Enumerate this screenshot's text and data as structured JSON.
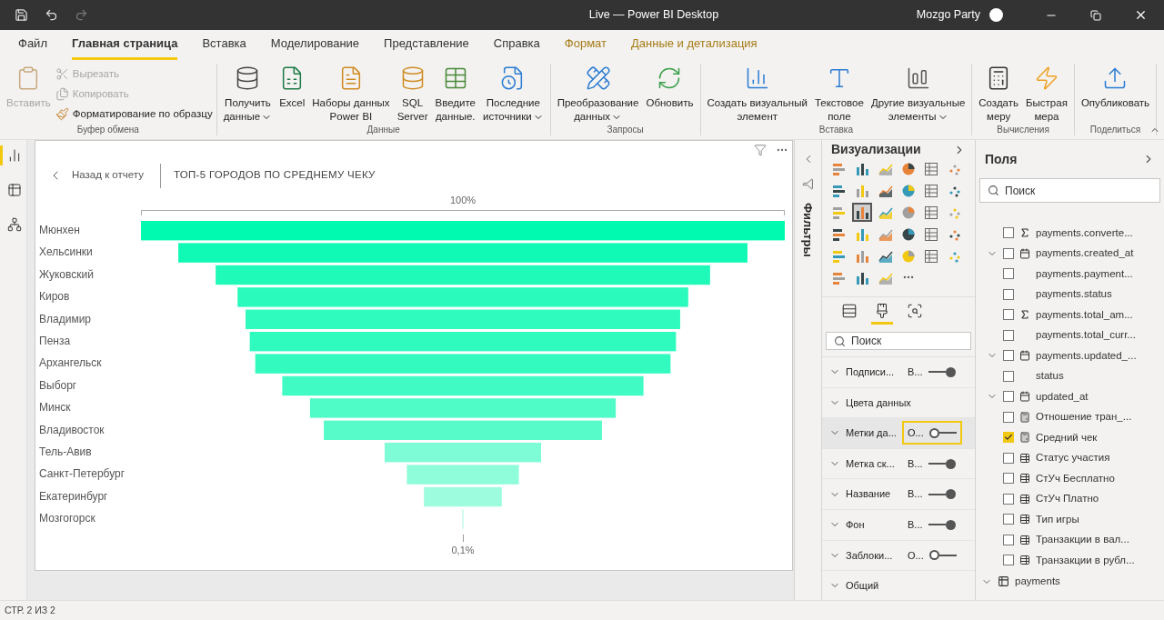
{
  "window": {
    "title": "Live — Power BI Desktop",
    "user": "Mozgo Party"
  },
  "ribbon_tabs": [
    {
      "label": "Файл",
      "kind": "normal",
      "selected": false
    },
    {
      "label": "Главная страница",
      "kind": "normal",
      "selected": true
    },
    {
      "label": "Вставка",
      "kind": "normal",
      "selected": false
    },
    {
      "label": "Моделирование",
      "kind": "normal",
      "selected": false
    },
    {
      "label": "Представление",
      "kind": "normal",
      "selected": false
    },
    {
      "label": "Справка",
      "kind": "normal",
      "selected": false
    },
    {
      "label": "Формат",
      "kind": "context",
      "selected": false
    },
    {
      "label": "Данные и детализация",
      "kind": "context",
      "selected": false
    }
  ],
  "ribbon_groups": [
    {
      "label": "Буфер обмена",
      "items": [
        {
          "kind": "large",
          "lines": [
            "Вставить"
          ],
          "disabled": true,
          "dropdown": false
        },
        {
          "kind": "small",
          "lines": [
            "Вырезать"
          ],
          "disabled": true,
          "dropdown": false
        },
        {
          "kind": "small",
          "lines": [
            "Копировать"
          ],
          "disabled": true,
          "dropdown": false
        },
        {
          "kind": "small",
          "lines": [
            "Форматирование по образцу"
          ],
          "disabled": false,
          "dropdown": false
        }
      ]
    },
    {
      "label": "Данные",
      "items": [
        {
          "kind": "large",
          "lines": [
            "Получить",
            "данные"
          ],
          "disabled": false,
          "dropdown": true
        },
        {
          "kind": "large",
          "lines": [
            "Excel"
          ],
          "disabled": false,
          "dropdown": false
        },
        {
          "kind": "large",
          "lines": [
            "Наборы данных",
            "Power BI"
          ],
          "disabled": false,
          "dropdown": false
        },
        {
          "kind": "large",
          "lines": [
            "SQL",
            "Server"
          ],
          "disabled": false,
          "dropdown": false
        },
        {
          "kind": "large",
          "lines": [
            "Введите",
            "данные."
          ],
          "disabled": false,
          "dropdown": false
        },
        {
          "kind": "large",
          "lines": [
            "Последние",
            "источники"
          ],
          "disabled": false,
          "dropdown": true
        }
      ]
    },
    {
      "label": "Запросы",
      "items": [
        {
          "kind": "large",
          "lines": [
            "Преобразование",
            "данных"
          ],
          "disabled": false,
          "dropdown": true
        },
        {
          "kind": "large",
          "lines": [
            "Обновить"
          ],
          "disabled": false,
          "dropdown": false
        }
      ]
    },
    {
      "label": "Вставка",
      "items": [
        {
          "kind": "large",
          "lines": [
            "Создать визуальный",
            "элемент"
          ],
          "disabled": false,
          "dropdown": false
        },
        {
          "kind": "large",
          "lines": [
            "Текстовое",
            "поле"
          ],
          "disabled": false,
          "dropdown": false
        },
        {
          "kind": "large",
          "lines": [
            "Другие визуальные",
            "элементы"
          ],
          "disabled": false,
          "dropdown": true
        }
      ]
    },
    {
      "label": "Вычисления",
      "items": [
        {
          "kind": "large",
          "lines": [
            "Создать",
            "меру"
          ],
          "disabled": false,
          "dropdown": false
        },
        {
          "kind": "large",
          "lines": [
            "Быстрая",
            "мера"
          ],
          "disabled": false,
          "dropdown": false
        }
      ]
    },
    {
      "label": "Поделиться",
      "items": [
        {
          "kind": "large",
          "lines": [
            "Опубликовать"
          ],
          "disabled": false,
          "dropdown": false
        }
      ]
    }
  ],
  "left_nav": [
    {
      "selected": true
    },
    {
      "selected": false
    },
    {
      "selected": false
    }
  ],
  "visual": {
    "back_label": "Назад к отчету",
    "title": "ТОП-5 ГОРОДОВ ПО СРЕДНЕМУ ЧЕКУ",
    "funnel": {
      "top_label": "100%",
      "bottom_label": "0,1%",
      "rows": [
        {
          "label": "Мюнхен"
        },
        {
          "label": "Хельсинки"
        },
        {
          "label": "Жуковский"
        },
        {
          "label": "Киров"
        },
        {
          "label": "Владимир"
        },
        {
          "label": "Пенза"
        },
        {
          "label": "Архангельск"
        },
        {
          "label": "Выборг"
        },
        {
          "label": "Минск"
        },
        {
          "label": "Владивосток"
        },
        {
          "label": "Тель-Авив"
        },
        {
          "label": "Санкт-Петербург"
        },
        {
          "label": "Екатеринбург"
        },
        {
          "label": "Мозгогорск"
        }
      ]
    }
  },
  "filters_pane": {
    "label": "Фильтры"
  },
  "visualizations_pane": {
    "title": "Визуализации",
    "visual_types": [
      {
        "selected": false
      },
      {
        "selected": false
      },
      {
        "selected": false
      },
      {
        "selected": false
      },
      {
        "selected": false
      },
      {
        "selected": false
      },
      {
        "selected": false
      },
      {
        "selected": false
      },
      {
        "selected": false
      },
      {
        "selected": false
      },
      {
        "selected": false
      },
      {
        "selected": false
      },
      {
        "selected": false
      },
      {
        "selected": true
      },
      {
        "selected": false
      },
      {
        "selected": false
      },
      {
        "selected": false
      },
      {
        "selected": false
      },
      {
        "selected": false
      },
      {
        "selected": false
      },
      {
        "selected": false
      },
      {
        "selected": false
      },
      {
        "selected": false
      },
      {
        "selected": false
      },
      {
        "selected": false
      },
      {
        "selected": false
      },
      {
        "selected": false
      },
      {
        "selected": false
      },
      {
        "selected": false
      },
      {
        "selected": false
      },
      {
        "selected": false
      },
      {
        "selected": false
      },
      {
        "selected": false
      }
    ],
    "pane_tabs": [
      {
        "selected": false
      },
      {
        "selected": true
      },
      {
        "selected": false
      }
    ],
    "search": {
      "placeholder": "Поиск"
    },
    "sections": [
      {
        "label": "Подписи...",
        "kind": "toggle",
        "value": "В...",
        "on": true,
        "focused": false
      },
      {
        "label": "Цвета данных",
        "kind": "plain",
        "focused": false
      },
      {
        "label": "Метки да...",
        "kind": "toggle",
        "value": "О...",
        "on": false,
        "focused": true
      },
      {
        "label": "Метка ск...",
        "kind": "toggle",
        "value": "В...",
        "on": true,
        "focused": false
      },
      {
        "label": "Название",
        "kind": "toggle",
        "value": "В...",
        "on": true,
        "focused": false
      },
      {
        "label": "Фон",
        "kind": "toggle",
        "value": "В...",
        "on": true,
        "focused": false
      },
      {
        "label": "Заблоки...",
        "kind": "toggle",
        "value": "О...",
        "on": false,
        "focused": false
      },
      {
        "label": "Общий",
        "kind": "plain",
        "focused": false
      }
    ]
  },
  "fields_pane": {
    "title": "Поля",
    "search": {
      "placeholder": "Поиск"
    },
    "fields": [
      {
        "label": "payments.converte...",
        "kind": "sigma",
        "checked": false
      },
      {
        "label": "payments.created_at",
        "kind": "calendar",
        "expanded": true,
        "checked": false
      },
      {
        "label": "payments.payment...",
        "kind": "plain",
        "checked": false
      },
      {
        "label": "payments.status",
        "kind": "plain",
        "checked": false
      },
      {
        "label": "payments.total_am...",
        "kind": "sigma",
        "checked": false
      },
      {
        "label": "payments.total_curr...",
        "kind": "plain",
        "checked": false
      },
      {
        "label": "payments.updated_...",
        "kind": "calendar",
        "expanded": true,
        "checked": false
      },
      {
        "label": "status",
        "kind": "plain",
        "checked": false
      },
      {
        "label": "updated_at",
        "kind": "calendar",
        "expanded": true,
        "checked": false
      },
      {
        "label": "Отношение тран_...",
        "kind": "measure",
        "checked": false
      },
      {
        "label": "Средний чек",
        "kind": "measure",
        "checked": true
      },
      {
        "label": "Статус участия",
        "kind": "column",
        "checked": false
      },
      {
        "label": "СтУч Бесплатно",
        "kind": "column",
        "checked": false
      },
      {
        "label": "СтУч Платно",
        "kind": "column",
        "checked": false
      },
      {
        "label": "Тип игры",
        "kind": "column",
        "checked": false
      },
      {
        "label": "Транзакции в вал...",
        "kind": "column",
        "checked": false
      },
      {
        "label": "Транзакции в рубл...",
        "kind": "column",
        "checked": false
      }
    ],
    "table": {
      "label": "payments",
      "expanded": true
    }
  },
  "status_bar": {
    "page": "СТР. 2 ИЗ 2"
  }
}
